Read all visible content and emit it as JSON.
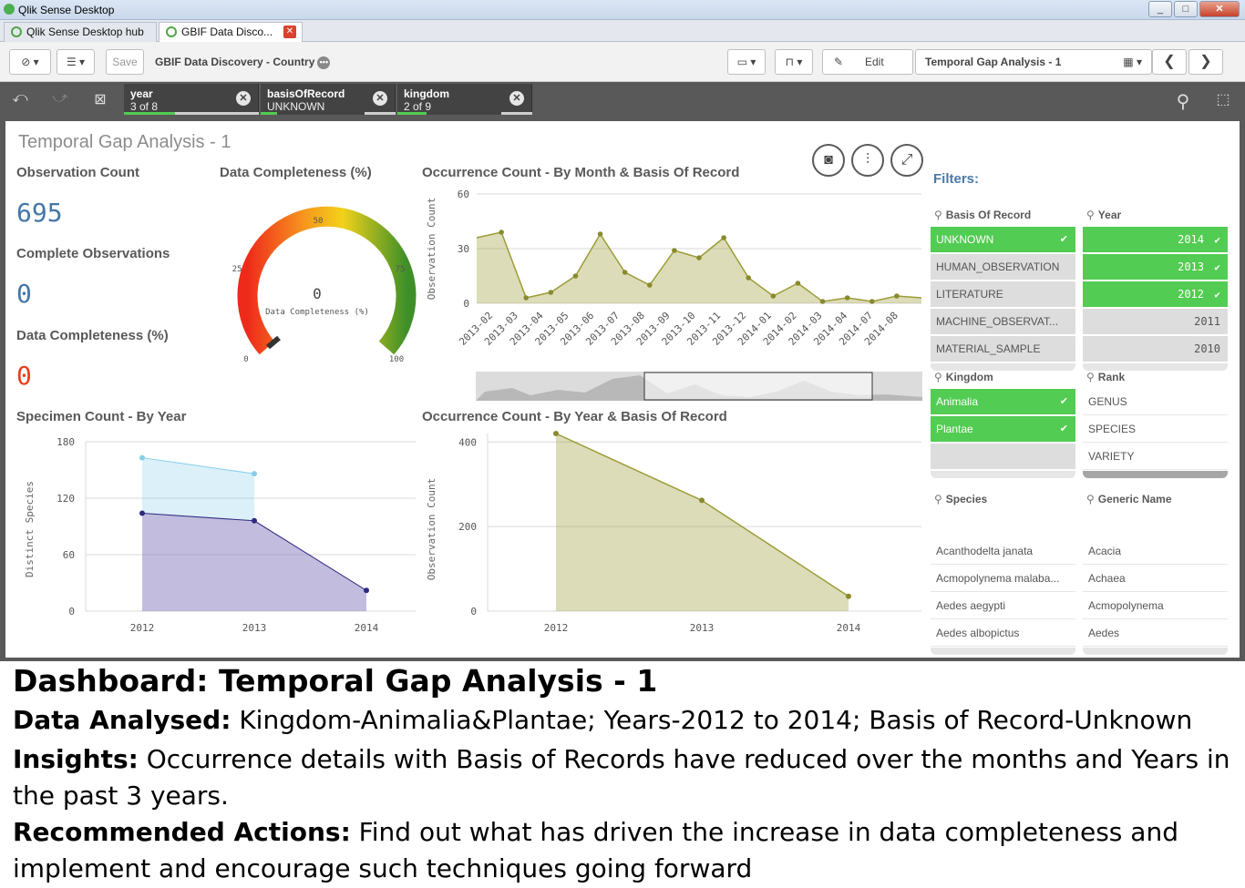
{
  "window": {
    "title": "Qlik Sense Desktop",
    "controls": [
      "_",
      "□",
      "✕"
    ]
  },
  "tabs": [
    {
      "label": "Qlik Sense Desktop hub"
    },
    {
      "label": "GBIF Data Disco..."
    }
  ],
  "toolbar": {
    "save_label": "Save",
    "app_title": "GBIF Data Discovery - Country",
    "edit_label": "Edit",
    "sheet_name": "Temporal Gap Analysis - 1"
  },
  "selections": [
    {
      "field": "year",
      "value": "3 of 8",
      "fill_fraction": 0.375
    },
    {
      "field": "basisOfRecord",
      "value": "UNKNOWN",
      "fill_fraction": 0.12
    },
    {
      "field": "kingdom",
      "value": "2 of 9",
      "fill_fraction": 0.22
    }
  ],
  "sheet": {
    "title": "Temporal Gap Analysis - 1",
    "kpis": [
      {
        "label": "Observation Count",
        "value": "695",
        "color": "#4477aa"
      },
      {
        "label": "Complete Observations",
        "value": "0",
        "color": "#4477aa"
      },
      {
        "label": "Data Completeness (%)",
        "value": "0",
        "color": "#e8401c"
      }
    ],
    "gauge": {
      "title": "Data Completeness (%)",
      "value": "0",
      "label": "Data Completeness (%)",
      "ticks": [
        "0",
        "25",
        "50",
        "75",
        "100"
      ]
    },
    "filters_label": "Filters:"
  },
  "listboxes": {
    "basis": {
      "title": "Basis Of Record",
      "items": [
        {
          "label": "UNKNOWN",
          "state": "sel"
        },
        {
          "label": "HUMAN_OBSERVATION",
          "state": "alt"
        },
        {
          "label": "LITERATURE",
          "state": "alt"
        },
        {
          "label": "MACHINE_OBSERVAT...",
          "state": "alt"
        },
        {
          "label": "MATERIAL_SAMPLE",
          "state": "alt"
        }
      ]
    },
    "year": {
      "title": "Year",
      "items": [
        {
          "label": "2014",
          "state": "sel"
        },
        {
          "label": "2013",
          "state": "sel"
        },
        {
          "label": "2012",
          "state": "sel"
        },
        {
          "label": "2011",
          "state": "alt"
        },
        {
          "label": "2010",
          "state": "alt"
        }
      ]
    },
    "kingdom": {
      "title": "Kingdom",
      "items": [
        {
          "label": "Animalia",
          "state": "sel"
        },
        {
          "label": "Plantae",
          "state": "sel"
        }
      ]
    },
    "rank": {
      "title": "Rank",
      "items": [
        {
          "label": "GENUS",
          "state": "poss"
        },
        {
          "label": "SPECIES",
          "state": "poss"
        },
        {
          "label": "VARIETY",
          "state": "poss"
        }
      ]
    },
    "species": {
      "title": "Species",
      "items": [
        {
          "label": "Acanthodelta janata",
          "state": "poss"
        },
        {
          "label": "Acmopolynema malaba...",
          "state": "poss"
        },
        {
          "label": "Aedes aegypti",
          "state": "poss"
        },
        {
          "label": "Aedes albopictus",
          "state": "poss"
        }
      ]
    },
    "generic": {
      "title": "Generic Name",
      "items": [
        {
          "label": "Acacia",
          "state": "poss"
        },
        {
          "label": "Achaea",
          "state": "poss"
        },
        {
          "label": "Acmopolynema",
          "state": "poss"
        },
        {
          "label": "Aedes",
          "state": "poss"
        }
      ]
    }
  },
  "chart_data": [
    {
      "id": "monthly",
      "type": "area",
      "title": "Occurrence Count - By Month & Basis Of Record",
      "ylabel": "Observation Count",
      "ylim": [
        0,
        60
      ],
      "yticks": [
        0,
        30,
        60
      ],
      "categories": [
        "2013-02",
        "2013-03",
        "2013-04",
        "2013-05",
        "2013-06",
        "2013-07",
        "2013-08",
        "2013-09",
        "2013-10",
        "2013-11",
        "2013-12",
        "2014-01",
        "2014-02",
        "2014-03",
        "2014-04",
        "2014-07",
        "2014-08"
      ],
      "series": [
        {
          "values": [
            36,
            39,
            3,
            6,
            15,
            38,
            17,
            10,
            29,
            25,
            36,
            14,
            4,
            11,
            1,
            3,
            1,
            4,
            3
          ]
        }
      ],
      "color": "#9c9c37"
    },
    {
      "id": "specimen",
      "type": "area",
      "title": "Specimen Count - By Year",
      "ylabel": "Distinct Species",
      "ylim": [
        0,
        180
      ],
      "yticks": [
        0,
        60,
        120,
        180
      ],
      "categories": [
        "2012",
        "2013",
        "2014"
      ],
      "series": [
        {
          "values": [
            163,
            146,
            null
          ],
          "color": "#87ceeb"
        },
        {
          "values": [
            104,
            96,
            22
          ],
          "color": "#2e2a82"
        }
      ]
    },
    {
      "id": "yearly",
      "type": "area",
      "title": "Occurrence Count - By Year & Basis Of Record",
      "ylabel": "Observation Count",
      "ylim": [
        0,
        420
      ],
      "yticks": [
        0,
        200,
        400
      ],
      "categories": [
        "2012",
        "2013",
        "2014"
      ],
      "series": [
        {
          "values": [
            420,
            262,
            35
          ]
        }
      ],
      "color": "#9c9c37"
    }
  ],
  "caption": {
    "heading": "Dashboard: Temporal Gap Analysis - 1",
    "line1_label": "Data Analysed:",
    "line1_text": " Kingdom-Animalia&Plantae; Years-2012 to 2014; Basis of Record-Unknown",
    "line2_label": "Insights:",
    "line2_text": " Occurrence details with Basis of Records have reduced over the months and Years in the past 3 years.",
    "line3_label": "Recommended Actions:",
    "line3_text": " Find out what has driven the increase in data completeness and implement and encourage such techniques going forward"
  }
}
